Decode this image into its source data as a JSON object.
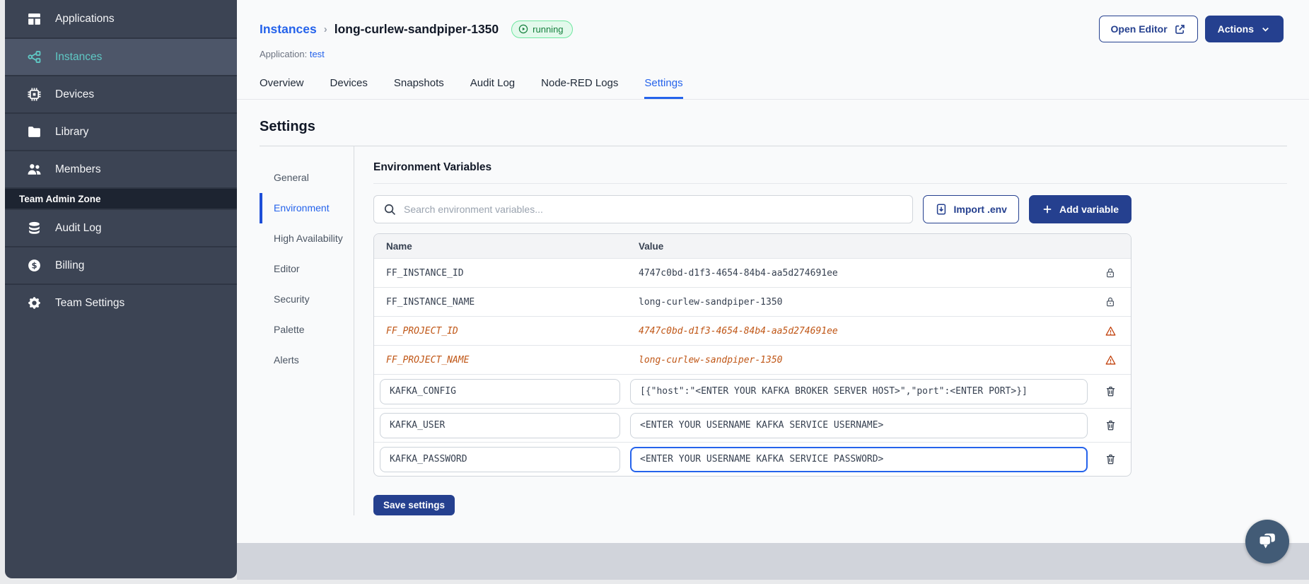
{
  "colors": {
    "accent_blue": "#2563eb",
    "button_navy": "#25408f",
    "sidebar_bg": "#3c4454",
    "sidebar_active_teal": "#5fc9c5",
    "running_green": "#15803d",
    "deprecated_orange": "#c05717",
    "chat_bubble": "#425b76"
  },
  "sidebar": {
    "items": [
      {
        "label": "Applications"
      },
      {
        "label": "Instances"
      },
      {
        "label": "Devices"
      },
      {
        "label": "Library"
      },
      {
        "label": "Members"
      }
    ],
    "section_label": "Team Admin Zone",
    "admin_items": [
      {
        "label": "Audit Log"
      },
      {
        "label": "Billing"
      },
      {
        "label": "Team Settings"
      }
    ]
  },
  "header": {
    "breadcrumb_parent": "Instances",
    "breadcrumb_separator": "›",
    "instance_name": "long-curlew-sandpiper-1350",
    "status_badge": "running",
    "application_label": "Application:",
    "application_name": "test",
    "open_editor_label": "Open Editor",
    "actions_label": "Actions"
  },
  "tabs": [
    "Overview",
    "Devices",
    "Snapshots",
    "Audit Log",
    "Node-RED Logs",
    "Settings"
  ],
  "settings": {
    "page_title": "Settings",
    "nav": [
      "General",
      "Environment",
      "High Availability",
      "Editor",
      "Security",
      "Palette",
      "Alerts"
    ],
    "active_nav": "Environment"
  },
  "env": {
    "section_title": "Environment Variables",
    "search_placeholder": "Search environment variables...",
    "import_button": "Import .env",
    "add_button": "Add variable",
    "columns": {
      "name": "Name",
      "value": "Value"
    },
    "rows": [
      {
        "name": "FF_INSTANCE_ID",
        "value": "4747c0bd-d1f3-4654-84b4-aa5d274691ee",
        "state": "locked"
      },
      {
        "name": "FF_INSTANCE_NAME",
        "value": "long-curlew-sandpiper-1350",
        "state": "locked"
      },
      {
        "name": "FF_PROJECT_ID",
        "value": "4747c0bd-d1f3-4654-84b4-aa5d274691ee",
        "state": "deprecated"
      },
      {
        "name": "FF_PROJECT_NAME",
        "value": "long-curlew-sandpiper-1350",
        "state": "deprecated"
      },
      {
        "name": "KAFKA_CONFIG",
        "value": "[{\"host\":\"<ENTER YOUR KAFKA BROKER SERVER HOST>\",\"port\":<ENTER PORT>}]",
        "state": "editable"
      },
      {
        "name": "KAFKA_USER",
        "value": "<ENTER YOUR USERNAME KAFKA SERVICE USERNAME>",
        "state": "editable"
      },
      {
        "name": "KAFKA_PASSWORD",
        "value": "<ENTER YOUR USERNAME KAFKA SERVICE PASSWORD>",
        "state": "editable-focused"
      }
    ],
    "save_button": "Save settings"
  }
}
